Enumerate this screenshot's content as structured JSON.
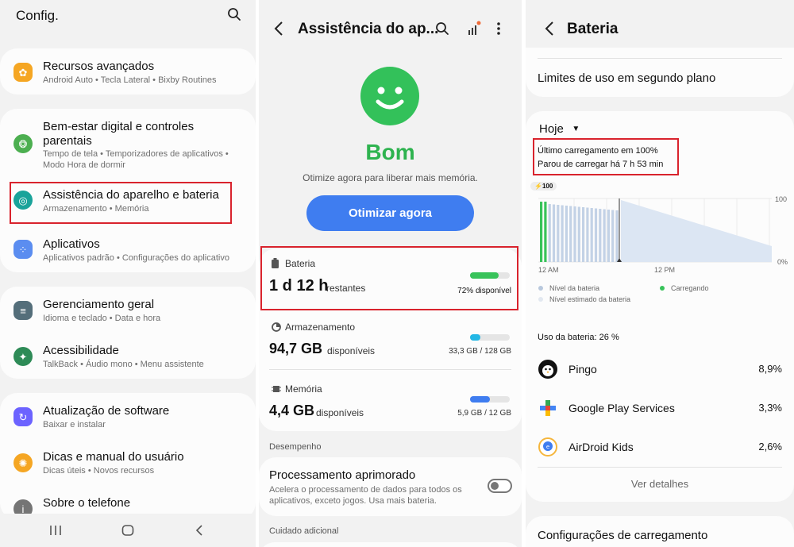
{
  "colors": {
    "highlight": "#d9232d",
    "accent_blue": "#3f7df0",
    "green": "#38c35a",
    "cyan": "#23b7e5"
  },
  "settings": {
    "title": "Config.",
    "items": [
      {
        "title": "Recursos avançados",
        "sub": "Android Auto  •  Tecla Lateral  •  Bixby Routines",
        "icon": "star-gear-icon"
      },
      {
        "title": "Bem-estar digital e controles parentais",
        "sub": "Tempo de tela  •  Temporizadores de aplicativos  •  Modo Hora de dormir",
        "icon": "wellbeing-icon"
      },
      {
        "title": "Assistência do aparelho e bateria",
        "sub": "Armazenamento  •  Memória",
        "icon": "device-care-icon"
      },
      {
        "title": "Aplicativos",
        "sub": "Aplicativos padrão  •  Configurações do aplicativo",
        "icon": "apps-grid-icon"
      },
      {
        "title": "Gerenciamento geral",
        "sub": "Idioma e teclado  •  Data e hora",
        "icon": "sliders-icon"
      },
      {
        "title": "Acessibilidade",
        "sub": "TalkBack  •  Áudio mono  •  Menu assistente",
        "icon": "accessibility-icon"
      },
      {
        "title": "Atualização de software",
        "sub": "Baixar e instalar",
        "icon": "update-icon"
      },
      {
        "title": "Dicas e manual do usuário",
        "sub": "Dicas úteis  •  Novos recursos",
        "icon": "lightbulb-icon"
      },
      {
        "title": "Sobre o telefone",
        "sub": "",
        "icon": "info-icon"
      }
    ]
  },
  "device_care": {
    "title": "Assistência do ap...",
    "status": "Bom",
    "message": "Otimize agora para liberar mais memória.",
    "optimize_button": "Otimizar agora",
    "battery": {
      "label": "Bateria",
      "time": "1 d 12 h",
      "time_suffix": "restantes",
      "available": "72% disponível",
      "level": 0.72
    },
    "storage": {
      "label": "Armazenamento",
      "value": "94,7 GB",
      "suffix": "disponíveis",
      "detail": "33,3 GB / 128 GB",
      "used": 0.26
    },
    "memory": {
      "label": "Memória",
      "value": "4,4 GB",
      "suffix": "disponíveis",
      "detail": "5,9 GB / 12 GB",
      "used": 0.49
    },
    "section_performance": "Desempenho",
    "processing": {
      "title": "Processamento aprimorado",
      "desc_line1": "Acelera o processamento de dados para todos os",
      "desc_line2": "aplicativos, exceto jogos. Usa mais bateria."
    },
    "section_care": "Cuidado adicional"
  },
  "battery": {
    "title": "Bateria",
    "background_limits": "Limites de uso em segundo plano",
    "period": "Hoje",
    "last_charge": "Último carregamento em 100%",
    "stopped": "Parou de carregar há 7 h 53 min",
    "badge": "100",
    "y_top": "100",
    "y_bottom": "0%",
    "x_left": "12 AM",
    "x_mid": "12 PM",
    "legend": {
      "level": "Nível da bateria",
      "charging": "Carregando",
      "estimated": "Nível estimado da bateria"
    },
    "usage_title": "Uso da bateria: 26 %",
    "apps": [
      {
        "name": "Pingo",
        "percent": "8,9%",
        "icon": "pingo-penguin-icon"
      },
      {
        "name": "Google Play Services",
        "percent": "3,3%",
        "icon": "play-services-icon"
      },
      {
        "name": "AirDroid Kids",
        "percent": "2,6%",
        "icon": "airdroid-kids-icon"
      }
    ],
    "details_link": "Ver detalhes",
    "charging_settings": "Configurações de carregamento"
  }
}
